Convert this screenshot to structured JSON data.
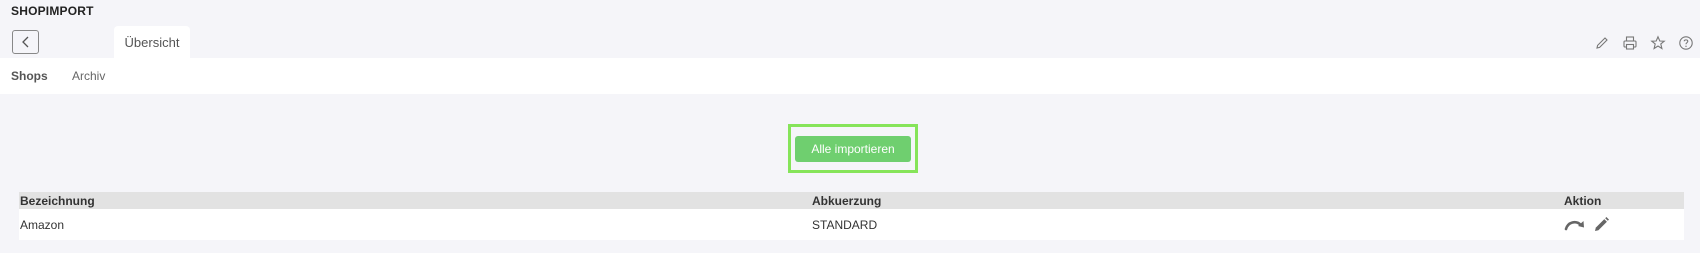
{
  "app": {
    "title": "SHOPIMPORT"
  },
  "tabs": [
    {
      "label": "Übersicht"
    }
  ],
  "subnav": [
    {
      "label": "Shops",
      "active": true
    },
    {
      "label": "Archiv",
      "active": false
    }
  ],
  "toolbar": {
    "icons": [
      "pencil-icon",
      "printer-icon",
      "star-icon",
      "help-icon"
    ]
  },
  "import_all": {
    "label": "Alle importieren",
    "color": "#6fcf6f",
    "highlight": "#86e45a"
  },
  "table": {
    "headers": [
      "Bezeichnung",
      "Abkuerzung",
      "Aktion"
    ],
    "rows": [
      {
        "name": "Amazon",
        "abbr": "STANDARD",
        "actions": [
          "redo-arrow-icon",
          "pencil-icon"
        ]
      }
    ]
  }
}
